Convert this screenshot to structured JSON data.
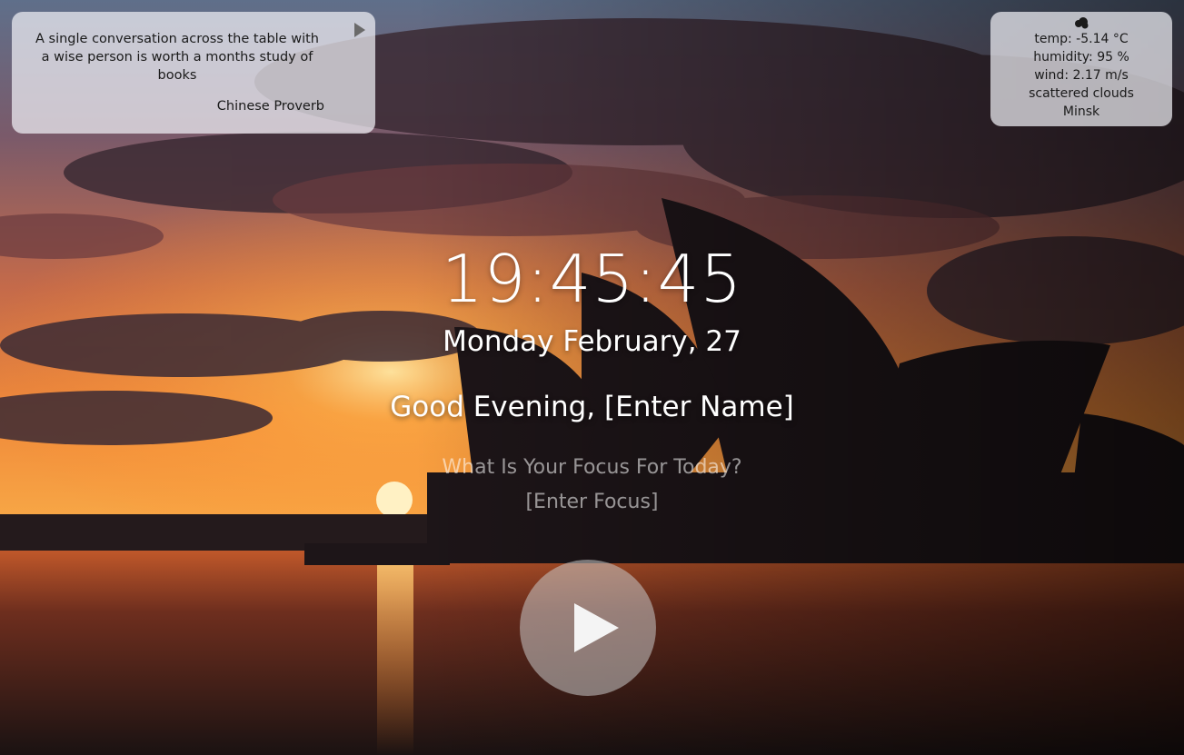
{
  "quote": {
    "text": "A single conversation across the table with a wise person is worth a months study of books",
    "author": "Chinese Proverb",
    "next_icon": "play-triangle-icon"
  },
  "weather": {
    "icon": "scattered-clouds-icon",
    "temp": "temp: -5.14 °C",
    "humidity": "humidity: 95 %",
    "wind": "wind: 2.17 m/s",
    "description": "scattered clouds",
    "city": "Minsk"
  },
  "clock": {
    "time": "19:45:45",
    "date": "Monday February, 27"
  },
  "greeting": {
    "prefix": "Good Evening, ",
    "name_placeholder": "[Enter Name]"
  },
  "focus": {
    "question": "What Is Your Focus For Today?",
    "placeholder": "[Enter Focus]"
  },
  "player": {
    "icon": "play-icon"
  },
  "background": {
    "scene": "sunset-over-harbor-with-opera-house",
    "colors": {
      "sky_top": "#5a4e6e",
      "sky_glow": "#f3923a",
      "sun": "#ffe9b0",
      "water": "#1c1414",
      "silhouette": "#1b1416"
    }
  }
}
